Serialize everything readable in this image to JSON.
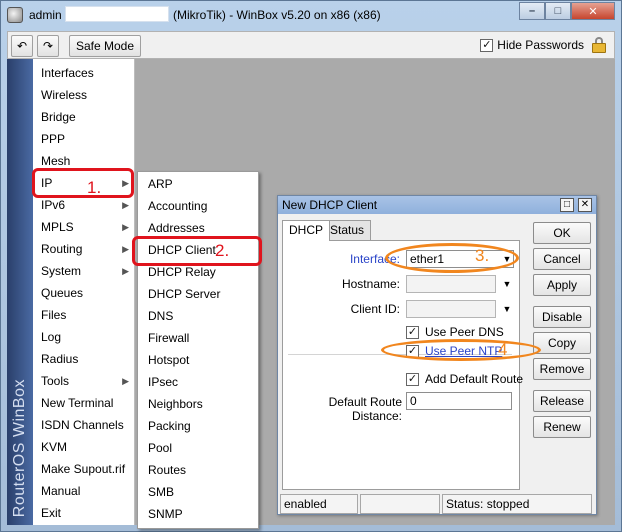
{
  "window": {
    "user": "admin",
    "title": "(MikroTik) - WinBox v5.20 on x86 (x86)",
    "buttons": {
      "minimize": "–",
      "maximize": "□",
      "close": "✕"
    }
  },
  "toolbar": {
    "undo_glyph": "↶",
    "redo_glyph": "↷",
    "safe_mode": "Safe Mode",
    "hide_passwords": "Hide Passwords",
    "hide_passwords_checked": "✓"
  },
  "sidebar": {
    "brand": "RouterOS WinBox",
    "items": [
      {
        "label": "Interfaces",
        "arrow": ""
      },
      {
        "label": "Wireless",
        "arrow": ""
      },
      {
        "label": "Bridge",
        "arrow": ""
      },
      {
        "label": "PPP",
        "arrow": ""
      },
      {
        "label": "Mesh",
        "arrow": ""
      },
      {
        "label": "IP",
        "arrow": "▶"
      },
      {
        "label": "IPv6",
        "arrow": "▶"
      },
      {
        "label": "MPLS",
        "arrow": "▶"
      },
      {
        "label": "Routing",
        "arrow": "▶"
      },
      {
        "label": "System",
        "arrow": "▶"
      },
      {
        "label": "Queues",
        "arrow": ""
      },
      {
        "label": "Files",
        "arrow": ""
      },
      {
        "label": "Log",
        "arrow": ""
      },
      {
        "label": "Radius",
        "arrow": ""
      },
      {
        "label": "Tools",
        "arrow": "▶"
      },
      {
        "label": "New Terminal",
        "arrow": ""
      },
      {
        "label": "ISDN Channels",
        "arrow": ""
      },
      {
        "label": "KVM",
        "arrow": ""
      },
      {
        "label": "Make Supout.rif",
        "arrow": ""
      },
      {
        "label": "Manual",
        "arrow": ""
      },
      {
        "label": "Exit",
        "arrow": ""
      }
    ]
  },
  "ip_submenu": {
    "items": [
      "ARP",
      "Accounting",
      "Addresses",
      "DHCP Client",
      "DHCP Relay",
      "DHCP Server",
      "DNS",
      "Firewall",
      "Hotspot",
      "IPsec",
      "Neighbors",
      "Packing",
      "Pool",
      "Routes",
      "SMB",
      "SNMP"
    ]
  },
  "dialog": {
    "title": "New DHCP Client",
    "restore_glyph": "□",
    "close_glyph": "✕",
    "tabs": [
      "DHCP",
      "Status"
    ],
    "interface_label": "Interface:",
    "interface_value": "ether1",
    "hostname_label": "Hostname:",
    "hostname_value": "",
    "client_id_label": "Client ID:",
    "client_id_value": "",
    "use_peer_dns": "Use Peer DNS",
    "use_peer_ntp": "Use Peer NTP",
    "add_default_route": "Add Default Route",
    "check_glyph": "✓",
    "distance_label": "Default Route Distance:",
    "distance_value": "0",
    "combo_glyph": "▼",
    "buttons": [
      "OK",
      "Cancel",
      "Apply",
      "Disable",
      "Copy",
      "Remove",
      "Release",
      "Renew"
    ],
    "status": {
      "state": "enabled",
      "middle": "",
      "status": "Status: stopped"
    }
  },
  "annotations": {
    "step1": "1.",
    "step2": "2.",
    "step3": "3.",
    "step4": "4",
    "rect_color": "#e0141d",
    "ellipse_color": "#f1861e"
  }
}
